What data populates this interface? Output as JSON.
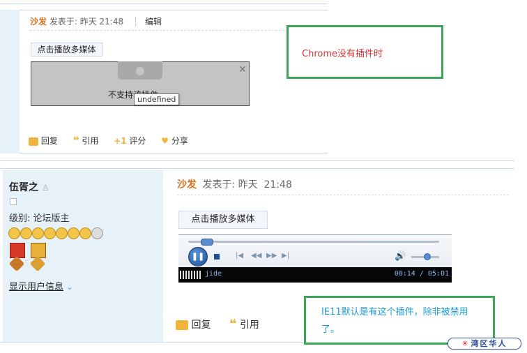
{
  "top_post": {
    "author": "沙发",
    "posted_prefix": "发表于:",
    "posted_time": "昨天 21:48",
    "edit_label": "编辑",
    "play_media_label": "点击播放多媒体",
    "plugin_unsupported": "不支持该插件",
    "tooltip": "undefined",
    "actions": {
      "reply": "回复",
      "quote": "引用",
      "rate": "评分",
      "share": "分享"
    }
  },
  "annotation_chrome": "Chrome没有插件时",
  "bottom_post": {
    "username": "伍胥之",
    "level_label": "级别: 论坛版主",
    "show_user_info": "显示用户信息",
    "author": "沙发",
    "posted_prefix": "发表于:",
    "posted_time": "昨天  21:48",
    "play_media_label": "点击播放多媒体",
    "player": {
      "track": "jide",
      "time": "00:14 / 05:01",
      "progress": 0.046
    },
    "actions": {
      "reply": "回复",
      "quote": "引用"
    }
  },
  "annotation_ie": "IE11默认是有这个插件，除非被禁用了。",
  "watermark": "湾区华人",
  "colors": {
    "annotation_border": "#3aa655",
    "author": "#d4711f",
    "ie_text": "#1a9ad6",
    "chrome_text": "#d33434"
  }
}
